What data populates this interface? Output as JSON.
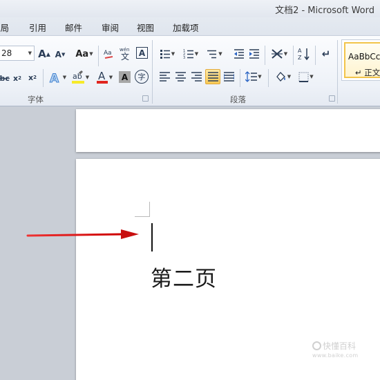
{
  "window": {
    "title": "文档2  -  Microsoft Word"
  },
  "tabs": [
    "布局",
    "引用",
    "邮件",
    "审阅",
    "视图",
    "加载项"
  ],
  "font_group": {
    "font_size": "28",
    "grow_font_label": "A",
    "shrink_font_label": "A",
    "change_case_label": "Aa",
    "label": "字体"
  },
  "paragraph_group": {
    "label": "段落"
  },
  "styles_group": {
    "preview_text": "AaBbCcD",
    "style_name": "↵ 正文"
  },
  "document": {
    "page2_text": "第二页"
  },
  "watermark": {
    "line1": "快懂百科",
    "line2": "www.baike.com"
  },
  "colors": {
    "arrow": "#d11c1c",
    "highlight": "#f7ea2a",
    "font_color": "#e0261f",
    "active_button": "#f7c955"
  }
}
